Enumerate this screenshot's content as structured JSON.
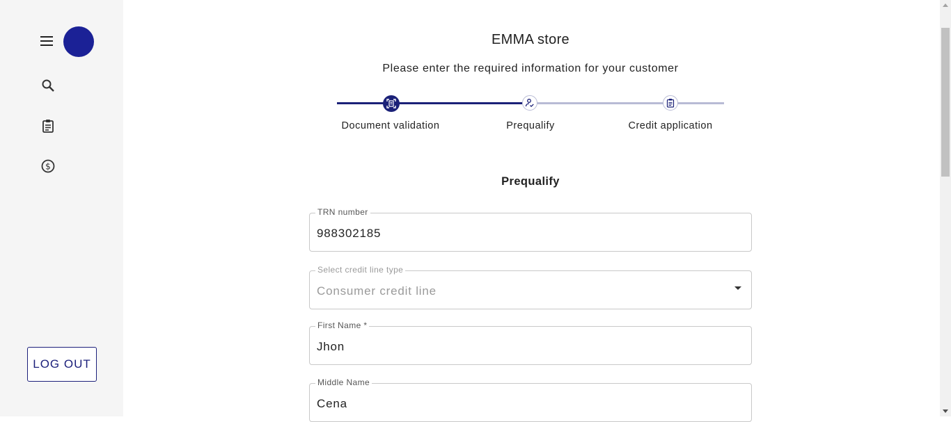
{
  "app": {
    "store_title": "EMMA store",
    "subtitle": "Please enter the required information for your customer"
  },
  "sidebar": {
    "items": [
      {
        "icon": "search-icon"
      },
      {
        "icon": "clipboard-icon"
      },
      {
        "icon": "dollar-circle-icon"
      }
    ],
    "logout_label": "LOG OUT"
  },
  "stepper": {
    "steps": [
      {
        "label": "Document validation",
        "status": "completed",
        "icon": "document-scan-icon"
      },
      {
        "label": "Prequalify",
        "status": "current",
        "icon": "person-check-icon"
      },
      {
        "label": "Credit application",
        "status": "pending",
        "icon": "clipboard-icon"
      }
    ]
  },
  "form": {
    "section_title": "Prequalify",
    "fields": [
      {
        "label": "TRN number",
        "value": "988302185"
      },
      {
        "label": "Select credit line type",
        "value": "Consumer credit line"
      },
      {
        "label": "First Name *",
        "value": "Jhon"
      },
      {
        "label": "Middle Name",
        "value": "Cena"
      }
    ]
  },
  "colors": {
    "primary": "#1b2178",
    "avatar": "#1b2196",
    "track_inactive": "#b8bbd5"
  }
}
